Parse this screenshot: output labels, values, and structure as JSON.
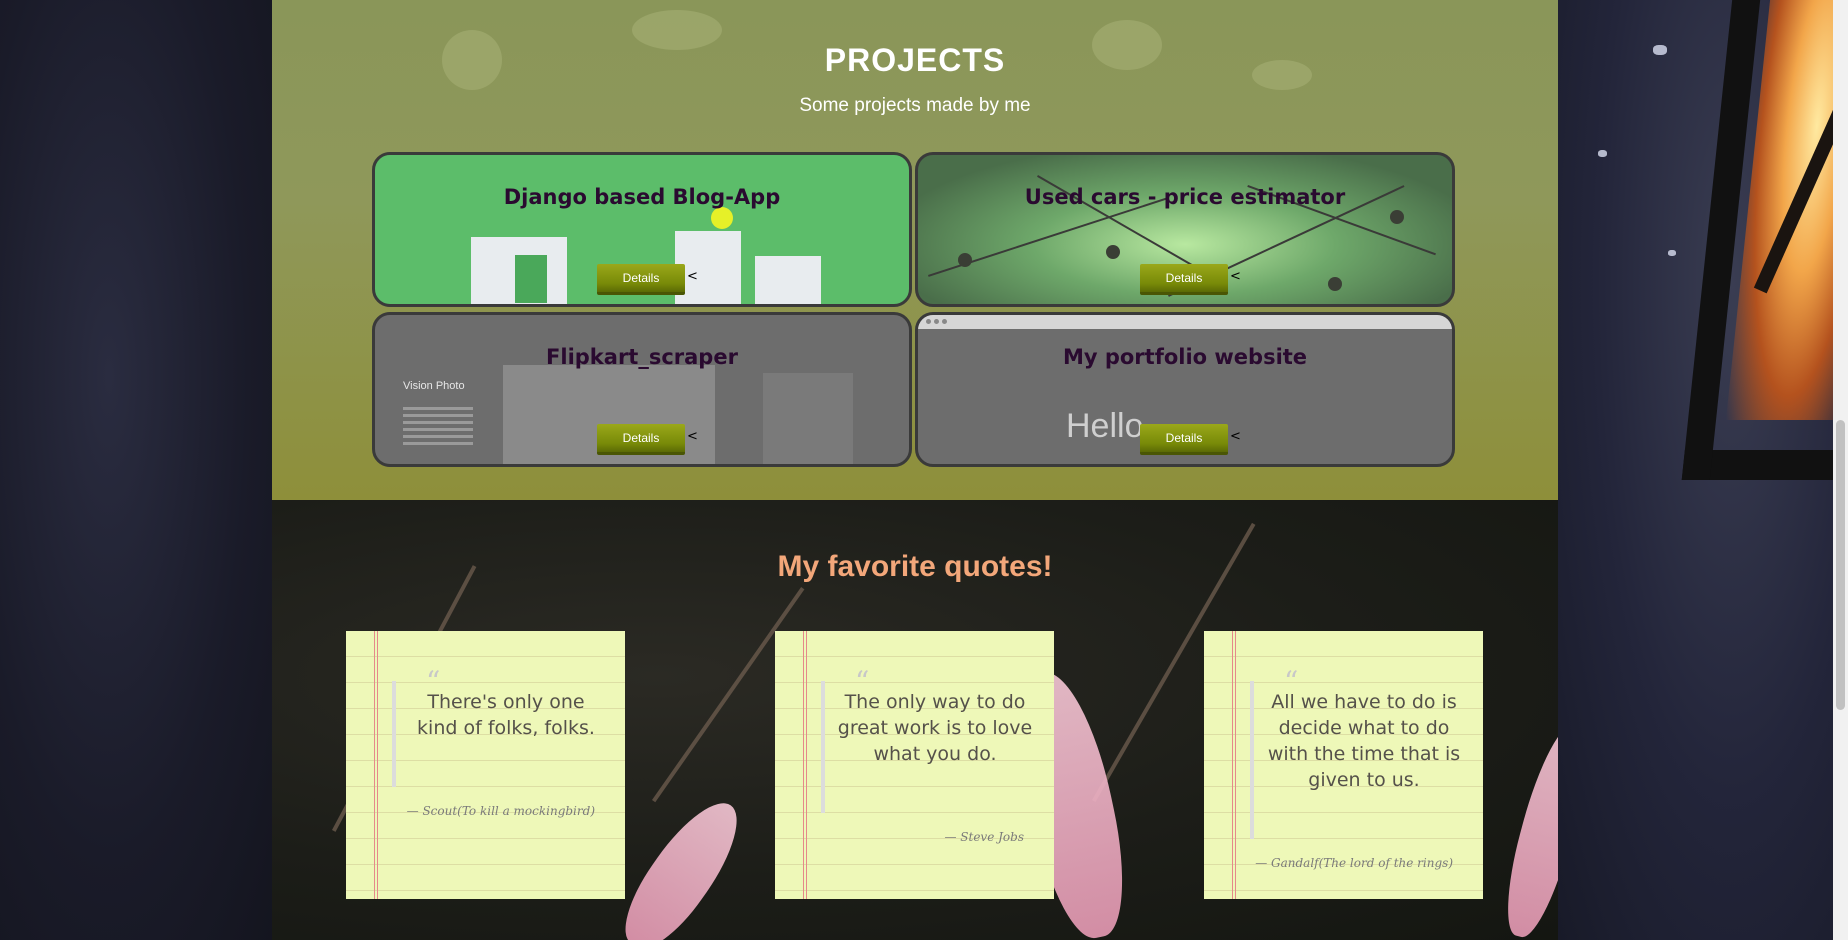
{
  "projects": {
    "title": "PROJECTS",
    "subtitle": "Some projects made by me",
    "cards": [
      {
        "title": "Django based Blog-App",
        "button": "Details",
        "caret": "<"
      },
      {
        "title": "Used cars - price estimator",
        "button": "Details",
        "caret": "<"
      },
      {
        "title": "Flipkart_scraper",
        "button": "Details",
        "caret": "<",
        "preview_text": "Vision Photo"
      },
      {
        "title": "My portfolio website",
        "button": "Details",
        "caret": "<",
        "preview_text": "Hello"
      }
    ]
  },
  "quotes": {
    "title": "My favorite quotes!",
    "quote_mark": "“",
    "items": [
      {
        "text": "There's only one kind of folks, folks.",
        "author": "— Scout(To kill a mockingbird)"
      },
      {
        "text": "The only way to do great work is to love what you do.",
        "author": "— Steve Jobs"
      },
      {
        "text": "All we have to do is decide what to do with the time that is given to us.",
        "author": "— Gandalf(The lord of the rings)"
      }
    ]
  },
  "colors": {
    "projects_bg": "#8a9659",
    "quotes_title": "#f3a77a",
    "button": "#788a08",
    "note": "#eef8b8"
  }
}
